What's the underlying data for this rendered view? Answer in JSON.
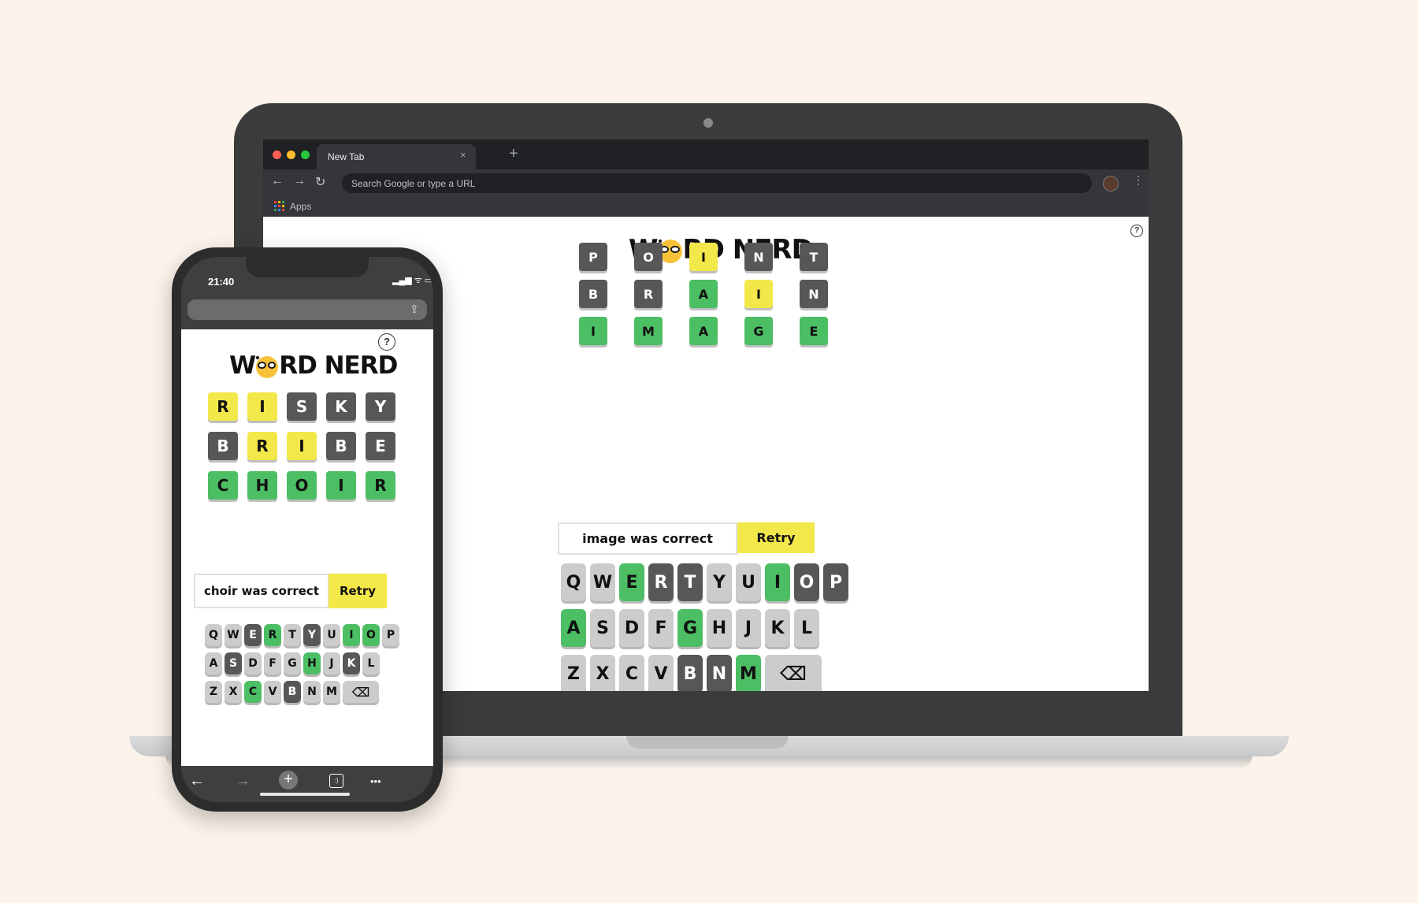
{
  "browser": {
    "tab_title": "New Tab",
    "tab_close": "×",
    "new_tab": "+",
    "back": "←",
    "forward": "→",
    "reload": "↻",
    "omnibox_placeholder": "Search Google or type a URL",
    "menu": "⋮",
    "bookmark_apps": "Apps"
  },
  "colors": {
    "correct": "#4cbe63",
    "present": "#f3e84a",
    "absent": "#575757",
    "unused": "#cccccc"
  },
  "desktop": {
    "logo_before": "W",
    "logo_after": "RD NERD",
    "help": "?",
    "board": [
      [
        {
          "l": "P",
          "s": "d"
        },
        {
          "l": "O",
          "s": "d"
        },
        {
          "l": "I",
          "s": "y"
        },
        {
          "l": "N",
          "s": "d"
        },
        {
          "l": "T",
          "s": "d"
        }
      ],
      [
        {
          "l": "B",
          "s": "d"
        },
        {
          "l": "R",
          "s": "d"
        },
        {
          "l": "A",
          "s": "g"
        },
        {
          "l": "I",
          "s": "y"
        },
        {
          "l": "N",
          "s": "d"
        }
      ],
      [
        {
          "l": "I",
          "s": "g"
        },
        {
          "l": "M",
          "s": "g"
        },
        {
          "l": "A",
          "s": "g"
        },
        {
          "l": "G",
          "s": "g"
        },
        {
          "l": "E",
          "s": "g"
        }
      ]
    ],
    "status": "image was correct",
    "retry": "Retry",
    "keyboard": [
      [
        {
          "l": "Q",
          "s": "l"
        },
        {
          "l": "W",
          "s": "l"
        },
        {
          "l": "E",
          "s": "g"
        },
        {
          "l": "R",
          "s": "d"
        },
        {
          "l": "T",
          "s": "d"
        },
        {
          "l": "Y",
          "s": "l"
        },
        {
          "l": "U",
          "s": "l"
        },
        {
          "l": "I",
          "s": "g"
        },
        {
          "l": "O",
          "s": "d"
        },
        {
          "l": "P",
          "s": "d"
        }
      ],
      [
        {
          "l": "A",
          "s": "g"
        },
        {
          "l": "S",
          "s": "l"
        },
        {
          "l": "D",
          "s": "l"
        },
        {
          "l": "F",
          "s": "l"
        },
        {
          "l": "G",
          "s": "g"
        },
        {
          "l": "H",
          "s": "l"
        },
        {
          "l": "J",
          "s": "l"
        },
        {
          "l": "K",
          "s": "l"
        },
        {
          "l": "L",
          "s": "l"
        }
      ],
      [
        {
          "l": "Z",
          "s": "l"
        },
        {
          "l": "X",
          "s": "l"
        },
        {
          "l": "C",
          "s": "l"
        },
        {
          "l": "V",
          "s": "l"
        },
        {
          "l": "B",
          "s": "d"
        },
        {
          "l": "N",
          "s": "d"
        },
        {
          "l": "M",
          "s": "g"
        },
        {
          "l": "⌫",
          "s": "l"
        }
      ]
    ]
  },
  "phone": {
    "time": "21:40",
    "status_icons": "▂▄▆ ᯤ ▭",
    "share": "⇪",
    "logo_before": "W",
    "logo_after": "RD NERD",
    "help": "?",
    "board": [
      [
        {
          "l": "R",
          "s": "y"
        },
        {
          "l": "I",
          "s": "y"
        },
        {
          "l": "S",
          "s": "d"
        },
        {
          "l": "K",
          "s": "d"
        },
        {
          "l": "Y",
          "s": "d"
        }
      ],
      [
        {
          "l": "B",
          "s": "d"
        },
        {
          "l": "R",
          "s": "y"
        },
        {
          "l": "I",
          "s": "y"
        },
        {
          "l": "B",
          "s": "d"
        },
        {
          "l": "E",
          "s": "d"
        }
      ],
      [
        {
          "l": "C",
          "s": "g"
        },
        {
          "l": "H",
          "s": "g"
        },
        {
          "l": "O",
          "s": "g"
        },
        {
          "l": "I",
          "s": "g"
        },
        {
          "l": "R",
          "s": "g"
        }
      ]
    ],
    "status": "choir was correct",
    "retry": "Retry",
    "keyboard": [
      [
        {
          "l": "Q",
          "s": "l"
        },
        {
          "l": "W",
          "s": "l"
        },
        {
          "l": "E",
          "s": "d"
        },
        {
          "l": "R",
          "s": "g"
        },
        {
          "l": "T",
          "s": "l"
        },
        {
          "l": "Y",
          "s": "d"
        },
        {
          "l": "U",
          "s": "l"
        },
        {
          "l": "I",
          "s": "g"
        },
        {
          "l": "O",
          "s": "g"
        },
        {
          "l": "P",
          "s": "l"
        }
      ],
      [
        {
          "l": "A",
          "s": "l"
        },
        {
          "l": "S",
          "s": "d"
        },
        {
          "l": "D",
          "s": "l"
        },
        {
          "l": "F",
          "s": "l"
        },
        {
          "l": "G",
          "s": "l"
        },
        {
          "l": "H",
          "s": "g"
        },
        {
          "l": "J",
          "s": "l"
        },
        {
          "l": "K",
          "s": "d"
        },
        {
          "l": "L",
          "s": "l"
        }
      ],
      [
        {
          "l": "Z",
          "s": "l"
        },
        {
          "l": "X",
          "s": "l"
        },
        {
          "l": "C",
          "s": "g"
        },
        {
          "l": "V",
          "s": "l"
        },
        {
          "l": "B",
          "s": "d"
        },
        {
          "l": "N",
          "s": "l"
        },
        {
          "l": "M",
          "s": "l"
        },
        {
          "l": "⌫",
          "s": "l"
        }
      ]
    ],
    "nav": {
      "back": "←",
      "forward": "→",
      "new_tab": "+",
      "tabs": ":)",
      "more": "•••"
    }
  }
}
